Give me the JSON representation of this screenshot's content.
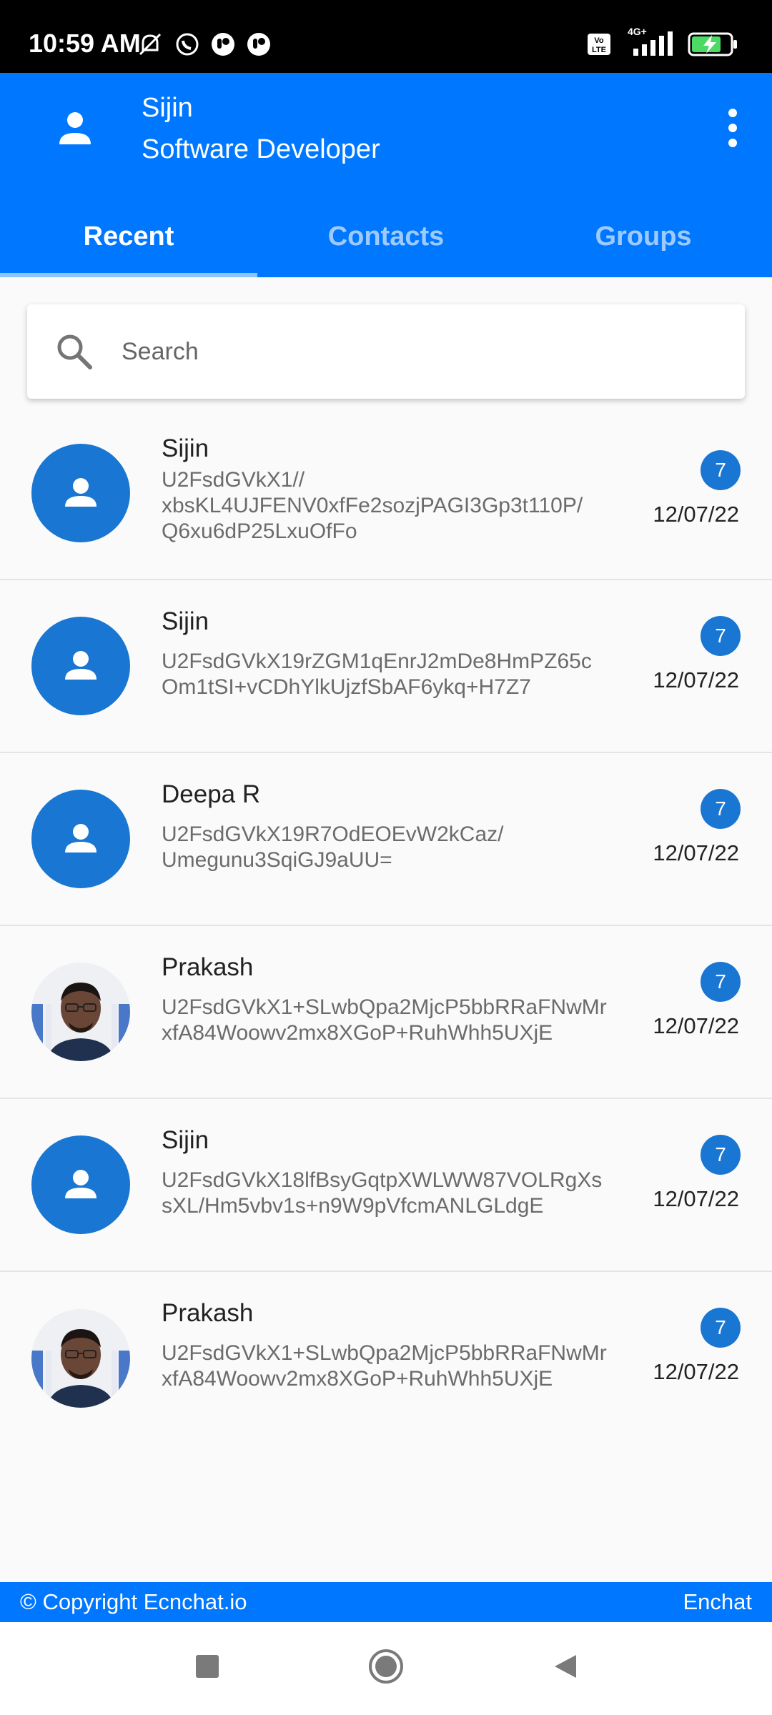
{
  "status_bar": {
    "time": "10:59 AM",
    "left_icons": [
      "mute-icon",
      "whatsapp-icon",
      "app-icon",
      "app-icon"
    ],
    "right_icons": [
      "volte-icon",
      "4g-signal-icon",
      "battery-charging-icon"
    ],
    "network_label": "4G+"
  },
  "header": {
    "user_name": "Sijin",
    "user_role": "Software Developer",
    "background_color": "#0077ff"
  },
  "tabs": [
    {
      "label": "Recent",
      "active": true
    },
    {
      "label": "Contacts",
      "active": false
    },
    {
      "label": "Groups",
      "active": false
    }
  ],
  "search": {
    "placeholder": "Search"
  },
  "chats": [
    {
      "name": "Sijin",
      "message": "U2FsdGVkX1//\nxbsKL4UJFENV0xfFe2sozjPAGI3Gp3t110P/\nQ6xu6dP25LxuOfFo",
      "badge": "7",
      "date": "12/07/22",
      "avatar": "default"
    },
    {
      "name": "Sijin",
      "message": "U2FsdGVkX19rZGM1qEnrJ2mDe8HmPZ65c\nOm1tSI+vCDhYlkUjzfSbAF6ykq+H7Z7",
      "badge": "7",
      "date": "12/07/22",
      "avatar": "default"
    },
    {
      "name": "Deepa R",
      "message": "U2FsdGVkX19R7OdEOEvW2kCaz/\nUmegunu3SqiGJ9aUU=",
      "badge": "7",
      "date": "12/07/22",
      "avatar": "default"
    },
    {
      "name": "Prakash",
      "message": "U2FsdGVkX1+SLwbQpa2MjcP5bbRRaFNwMr\nxfA84Woowv2mx8XGoP+RuhWhh5UXjE",
      "badge": "7",
      "date": "12/07/22",
      "avatar": "photo"
    },
    {
      "name": "Sijin",
      "message": "U2FsdGVkX18lfBsyGqtpXWLWW87VOLRgXs\nsXL/Hm5vbv1s+n9W9pVfcmANLGLdgE",
      "badge": "7",
      "date": "12/07/22",
      "avatar": "default"
    },
    {
      "name": "Prakash",
      "message": "U2FsdGVkX1+SLwbQpa2MjcP5bbRRaFNwMr\nxfA84Woowv2mx8XGoP+RuhWhh5UXjE",
      "badge": "7",
      "date": "12/07/22",
      "avatar": "photo"
    }
  ],
  "footer": {
    "copyright": "© Copyright Ecnchat.io",
    "brand": "Enchat"
  },
  "nav": [
    "recents-square-icon",
    "home-circle-icon",
    "back-triangle-icon"
  ]
}
